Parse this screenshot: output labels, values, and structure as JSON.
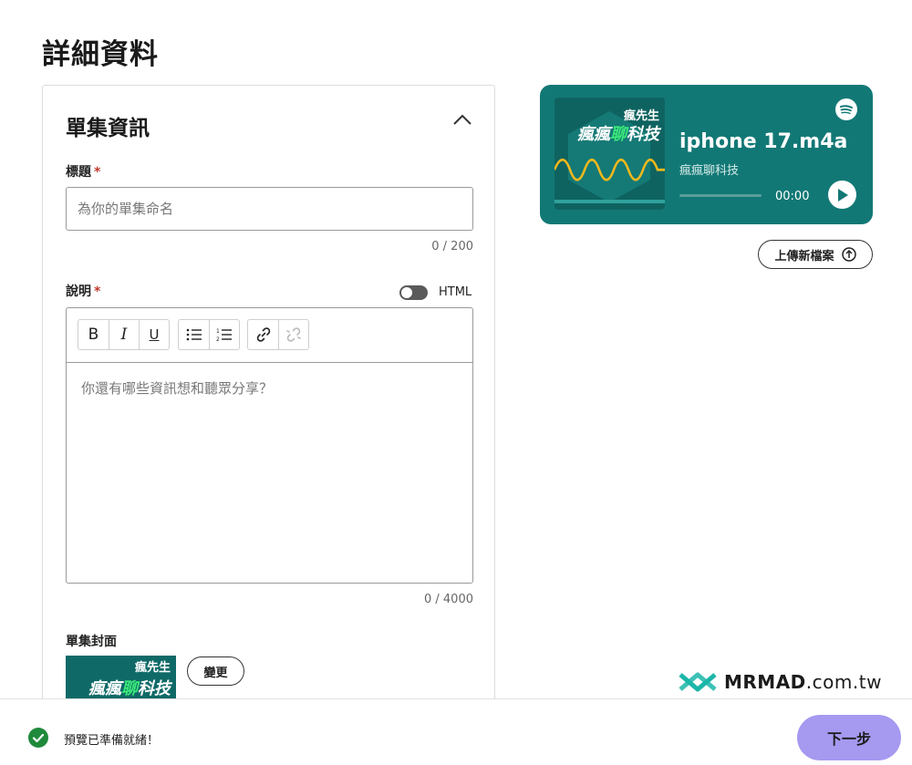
{
  "page": {
    "title": "詳細資料"
  },
  "episode_card": {
    "title": "單集資訊",
    "title_field": {
      "label": "標題",
      "required_mark": "*",
      "placeholder": "為你的單集命名",
      "value": "",
      "counter": "0 / 200"
    },
    "description_field": {
      "label": "說明",
      "required_mark": "*",
      "html_toggle_label": "HTML",
      "html_toggle_on": false,
      "placeholder": "你還有哪些資訊想和聽眾分享？",
      "counter": "0 / 4000",
      "toolbar": {
        "bold": "B",
        "italic": "I",
        "underline": "U"
      }
    },
    "cover": {
      "label": "單集封面",
      "change_button": "變更"
    }
  },
  "cover_art": {
    "top_text": "瘋先生",
    "main_text_a": "瘋瘋",
    "main_text_b": "聊",
    "main_text_c": "科技"
  },
  "player": {
    "track_title": "iphone 17.m4a",
    "artist": "瘋瘋聊科技",
    "time": "00:00",
    "progress": 0
  },
  "upload_button": "上傳新檔案",
  "watermark": {
    "brand": "MRMAD",
    "domain": ".com.tw"
  },
  "status": {
    "text": "預覽已準備就緒！"
  },
  "next_button": "下一步",
  "colors": {
    "player_bg": "#127875",
    "wave": "#f2b81c",
    "accent_green": "#3bea7a",
    "next_button_bg": "#a599f0",
    "status_green": "#1f8a3b",
    "required": "#c0392b"
  }
}
